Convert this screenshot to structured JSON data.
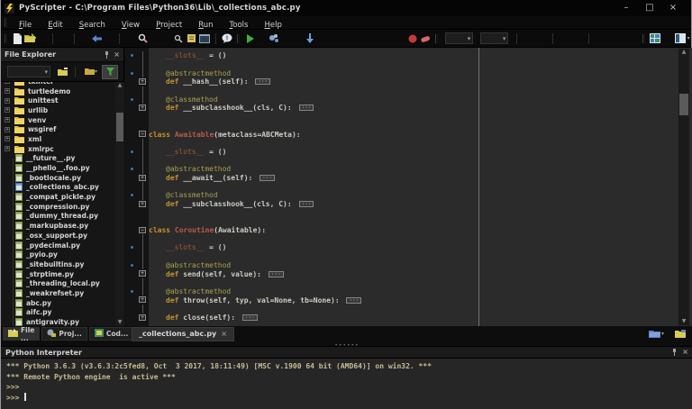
{
  "window": {
    "title": "PyScripter - C:\\Program Files\\Python36\\Lib\\_collections_abc.py",
    "controls": [
      "minimize",
      "maximize",
      "close"
    ]
  },
  "menu": {
    "items": [
      "File",
      "Edit",
      "Search",
      "View",
      "Project",
      "Run",
      "Tools",
      "Help"
    ]
  },
  "toolbar": {
    "icons": [
      "new-file",
      "open-file",
      "back-arrow",
      "find",
      "find-in-files",
      "todo-list",
      "editor-window",
      "messages",
      "run",
      "debug",
      "step",
      "record-macro",
      "stop-macro",
      "grid-view",
      "layout-view"
    ]
  },
  "file_explorer": {
    "title": "File Explorer",
    "toolbar_icons": [
      "path-combo",
      "new-folder",
      "folder-options",
      "filter"
    ],
    "folders": [
      "tkinter",
      "turtledemo",
      "unittest",
      "urllib",
      "venv",
      "wsgiref",
      "xml",
      "xmlrpc"
    ],
    "files": [
      "__future__.py",
      "__phello__.foo.py",
      "_bootlocale.py",
      "_collections_abc.py",
      "_compat_pickle.py",
      "_compression.py",
      "_dummy_thread.py",
      "_markupbase.py",
      "_osx_support.py",
      "_pydecimal.py",
      "_pyio.py",
      "_sitebuiltins.py",
      "_strptime.py",
      "_threading_local.py",
      "_weakrefset.py",
      "abc.py",
      "aifc.py",
      "antigravity.py"
    ],
    "selected_file": "_collections_abc.py",
    "tabs": [
      {
        "label": "File ...",
        "icon": "file-explorer-tab-icon",
        "active": true
      },
      {
        "label": "Proj...",
        "icon": "project-explorer-tab-icon",
        "active": false
      },
      {
        "label": "Cod...",
        "icon": "code-explorer-tab-icon",
        "active": false
      }
    ]
  },
  "editor": {
    "tab_label": "_collections_abc.py",
    "lines": [
      {
        "d": 1,
        "f": "|",
        "ind": 1,
        "t": [
          [
            "__slots__",
            "dun"
          ],
          [
            " = ()",
            "pln"
          ]
        ]
      },
      {
        "f": "|"
      },
      {
        "d": 1,
        "f": "|",
        "ind": 1,
        "t": [
          [
            "@abstractmethod",
            "dec"
          ]
        ]
      },
      {
        "f": "+",
        "ind": 1,
        "t": [
          [
            "def ",
            "kw"
          ],
          [
            "__hash__(self): ",
            "pln"
          ],
          [
            "···",
            "box"
          ]
        ]
      },
      {
        "f": "|"
      },
      {
        "d": 1,
        "f": "|",
        "ind": 1,
        "t": [
          [
            "@classmethod",
            "dec"
          ]
        ]
      },
      {
        "f": "+",
        "ind": 1,
        "t": [
          [
            "def ",
            "kw"
          ],
          [
            "__subclasshook__(cls, C): ",
            "pln"
          ],
          [
            "···",
            "box"
          ]
        ]
      },
      {},
      {},
      {
        "f": "-",
        "ind": 0,
        "t": [
          [
            "class ",
            "kw"
          ],
          [
            "Awaitable",
            "cls"
          ],
          [
            "(metaclass=ABCMeta):",
            "pln"
          ]
        ]
      },
      {
        "f": "|"
      },
      {
        "d": 1,
        "f": "|",
        "ind": 1,
        "t": [
          [
            "__slots__",
            "dun"
          ],
          [
            " = ()",
            "pln"
          ]
        ]
      },
      {
        "f": "|"
      },
      {
        "d": 1,
        "f": "|",
        "ind": 1,
        "t": [
          [
            "@abstractmethod",
            "dec"
          ]
        ]
      },
      {
        "f": "+",
        "ind": 1,
        "t": [
          [
            "def ",
            "kw"
          ],
          [
            "__await__(self): ",
            "pln"
          ],
          [
            "···",
            "box"
          ]
        ]
      },
      {
        "f": "|"
      },
      {
        "d": 1,
        "f": "|",
        "ind": 1,
        "t": [
          [
            "@classmethod",
            "dec"
          ]
        ]
      },
      {
        "f": "+",
        "ind": 1,
        "t": [
          [
            "def ",
            "kw"
          ],
          [
            "__subclasshook__(cls, C): ",
            "pln"
          ],
          [
            "···",
            "box"
          ]
        ]
      },
      {},
      {},
      {
        "f": "-",
        "ind": 0,
        "t": [
          [
            "class ",
            "kw"
          ],
          [
            "Coroutine",
            "cls"
          ],
          [
            "(Awaitable):",
            "pln"
          ]
        ]
      },
      {
        "f": "|"
      },
      {
        "d": 1,
        "f": "|",
        "ind": 1,
        "t": [
          [
            "__slots__",
            "dun"
          ],
          [
            " = ()",
            "pln"
          ]
        ]
      },
      {
        "f": "|"
      },
      {
        "d": 1,
        "f": "|",
        "ind": 1,
        "t": [
          [
            "@abstractmethod",
            "dec"
          ]
        ]
      },
      {
        "f": "+",
        "ind": 1,
        "t": [
          [
            "def ",
            "kw"
          ],
          [
            "send(self, value): ",
            "pln"
          ],
          [
            "···",
            "box"
          ]
        ]
      },
      {
        "f": "|"
      },
      {
        "d": 1,
        "f": "|",
        "ind": 1,
        "t": [
          [
            "@abstractmethod",
            "dec"
          ]
        ]
      },
      {
        "f": "+",
        "ind": 1,
        "t": [
          [
            "def ",
            "kw"
          ],
          [
            "throw(self, typ, val=None, tb=None): ",
            "pln"
          ],
          [
            "···",
            "box"
          ]
        ]
      },
      {
        "f": "|"
      },
      {
        "f": "+",
        "ind": 1,
        "t": [
          [
            "def ",
            "kw"
          ],
          [
            "close(self): ",
            "pln"
          ],
          [
            "···",
            "box"
          ]
        ]
      }
    ]
  },
  "interpreter": {
    "title": "Python Interpreter",
    "lines": [
      "*** Python 3.6.3 (v3.6.3:2c5fed8, Oct  3 2017, 18:11:49) [MSC v.1900 64 bit (AMD64)] on win32. ***",
      "*** Remote Python engine  is active ***",
      ">>>",
      ">>> "
    ],
    "cursor_line": 3
  },
  "colors": {
    "keyword": "#c6922f",
    "decorator": "#a3a150",
    "dunder": "#a9543f",
    "classname": "#b95b4b",
    "editor_bg": "#2b2b2b",
    "gutter_bg": "#141414",
    "marker_dot": "#3b6fd4",
    "console_text": "#c7bd92",
    "folder_icon": "#e3be39",
    "selected_file_icon": "#3b78d4",
    "run_icon": "#3fae3f",
    "record_icon": "#c23b3b"
  }
}
